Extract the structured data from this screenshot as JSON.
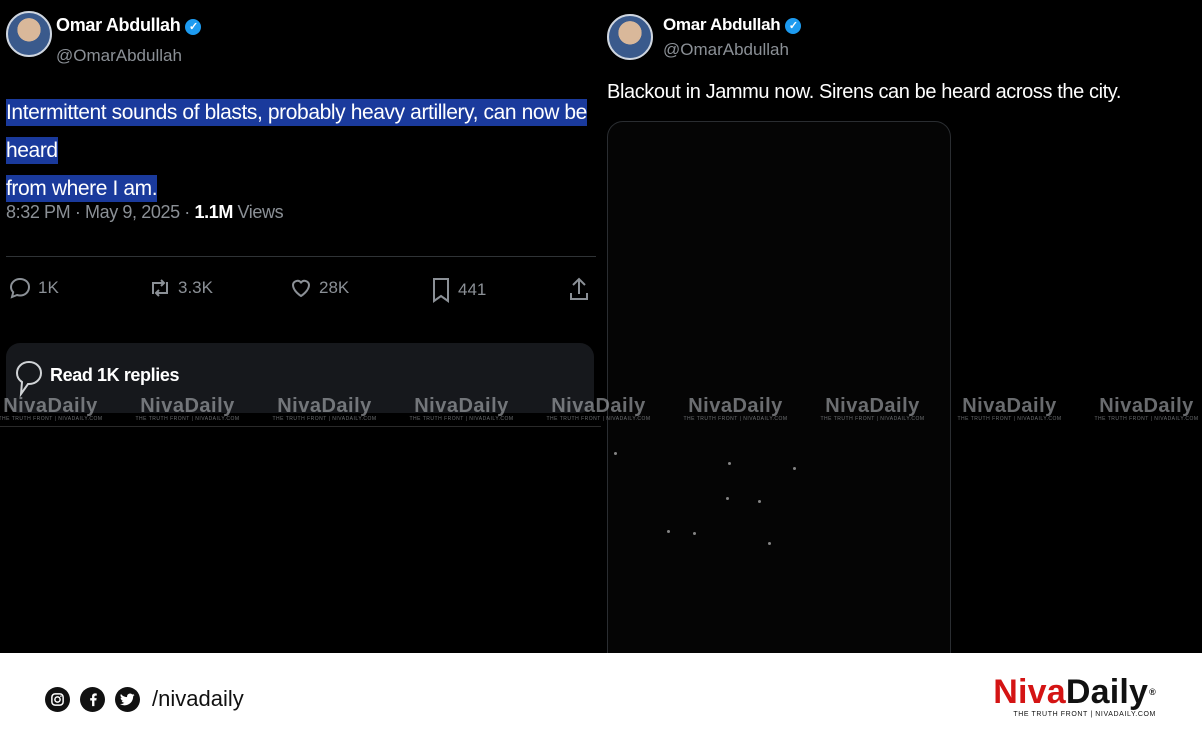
{
  "left_tweet": {
    "author_name": "Omar Abdullah",
    "author_handle": "@OmarAbdullah",
    "text_line1": "Intermittent sounds of blasts, probably heavy artillery, can now be heard",
    "text_line2": "from where I am.",
    "timestamp": "8:32 PM · May 9, 2025 · ",
    "views_count": "1.1M",
    "views_label": " Views",
    "actions": {
      "replies": "1K",
      "reposts": "3.3K",
      "likes": "28K",
      "bookmarks": "441"
    },
    "read_replies_label": "Read 1K replies"
  },
  "right_tweet": {
    "author_name": "Omar Abdullah",
    "author_handle": "@OmarAbdullah",
    "text": "Blackout in Jammu now. Sirens can be heard across the city."
  },
  "watermark": {
    "main": "NivaDaily",
    "sub": "THE TRUTH FRONT | NIVADAILY.COM"
  },
  "footer": {
    "social_handle": "/nivadaily",
    "brand_red": "Niva",
    "brand_black": "Daily",
    "brand_reg": "®",
    "brand_tagline": "THE TRUTH FRONT | NIVADAILY.COM"
  },
  "colors": {
    "highlight": "#1a3a9c",
    "verified": "#1d9bf0",
    "brand_red": "#d41414",
    "muted": "#8b9096"
  },
  "icons": [
    "verified-badge-icon",
    "more-icon",
    "reply-icon",
    "repost-icon",
    "like-icon",
    "bookmark-icon",
    "share-icon",
    "chat-bubble-icon",
    "instagram-icon",
    "facebook-icon",
    "twitter-icon"
  ]
}
